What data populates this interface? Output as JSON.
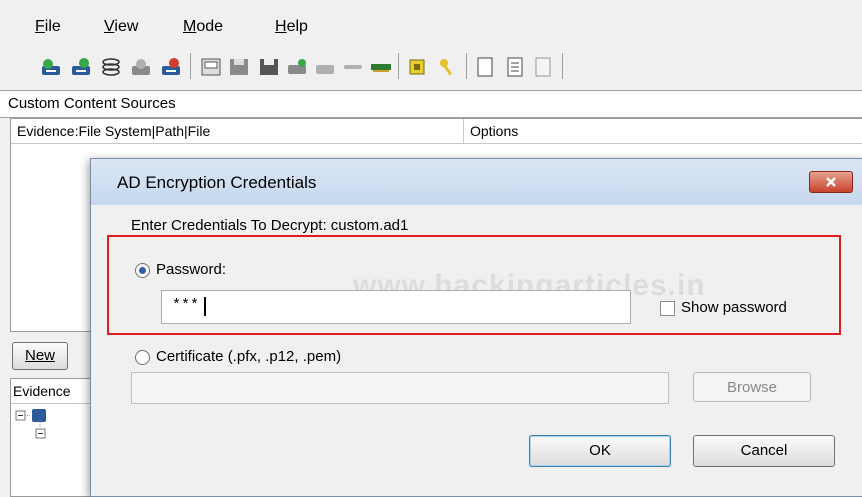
{
  "menu": [
    "File",
    "View",
    "Mode",
    "Help"
  ],
  "section_title": "Custom Content Sources",
  "columns": [
    "Evidence:File System|Path|File",
    "Options"
  ],
  "new_button": "New",
  "evidence_label": "Evidence",
  "dialog": {
    "title": "AD Encryption Credentials",
    "prompt": "Enter Credentials To Decrypt: custom.ad1",
    "password_label": "Password:",
    "password_value": "***",
    "show_password_label": "Show password",
    "certificate_label": "Certificate (.pfx, .p12, .pem)",
    "certificate_value": "",
    "browse_label": "Browse",
    "ok_label": "OK",
    "cancel_label": "Cancel",
    "watermark": "www.hackingarticles.in"
  },
  "toolbar_icons": [
    "add-evidence-icon",
    "add-image-icon",
    "add-folder-icon",
    "remove-evidence-icon",
    "remove-all-icon",
    "image-drive-icon",
    "save-icon",
    "export-icon",
    "export-files-icon",
    "create-disk-icon",
    "unmount-icon",
    "memory-icon",
    "hash-icon",
    "key-icon",
    "new-document-icon",
    "file-list-icon",
    "directory-listing-icon"
  ],
  "colors": {
    "highlight": "#e01e1e",
    "title_bar": "#c6d8ee",
    "close_button": "#c7452d"
  }
}
